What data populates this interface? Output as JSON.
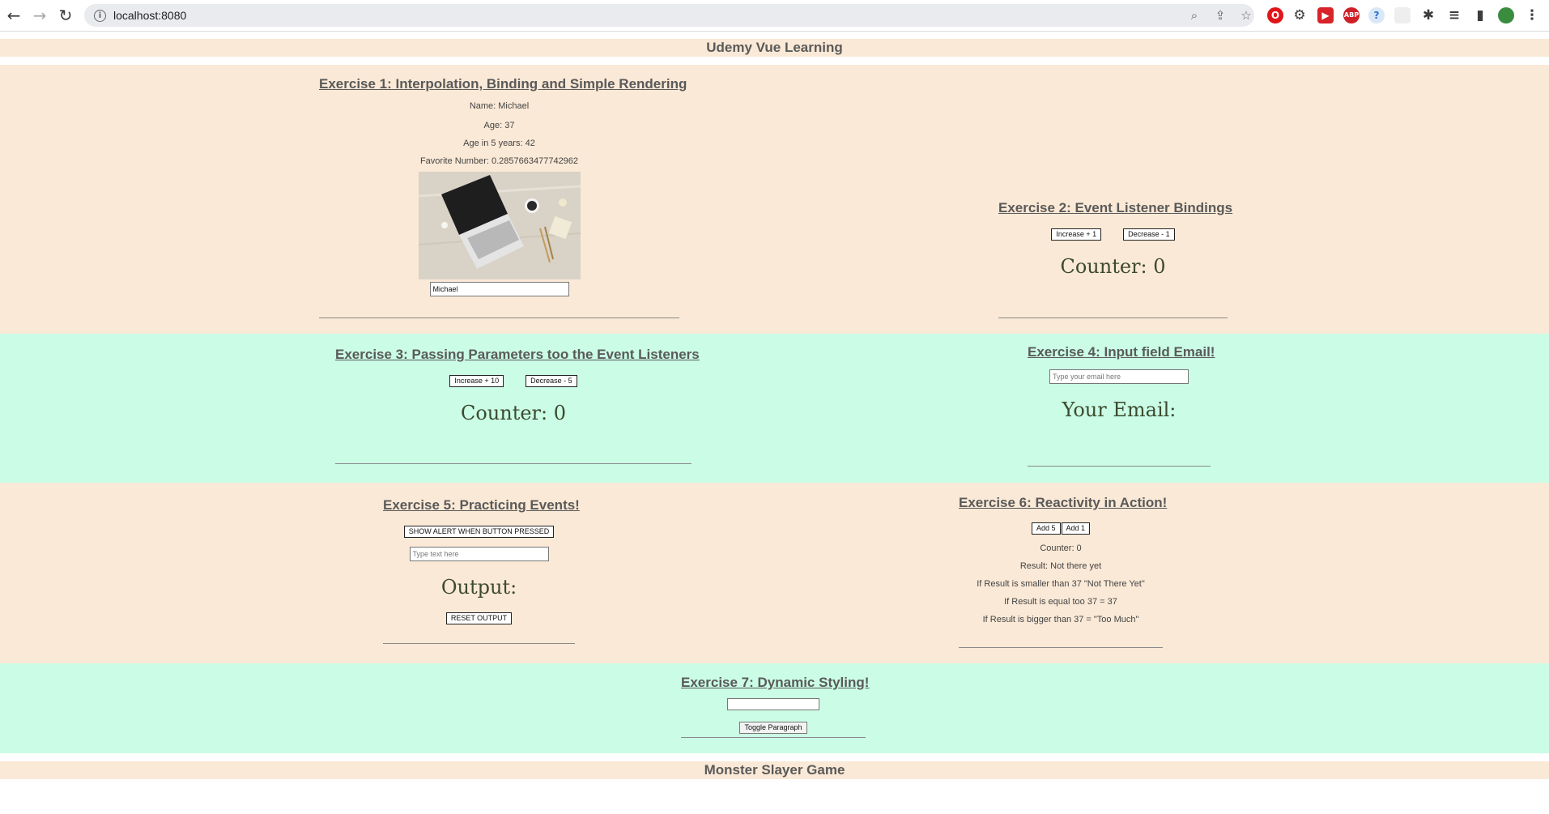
{
  "browser": {
    "url": "localhost:8080"
  },
  "header": {
    "title": "Udemy Vue Learning"
  },
  "footer": {
    "title": "Monster Slayer Game"
  },
  "ex1": {
    "title": "Exercise 1: Interpolation, Binding and Simple Rendering",
    "name": "Name: Michael",
    "age": "Age: 37",
    "age5": "Age in 5 years: 42",
    "fav": "Favorite Number: 0.2857663477742962",
    "input_value": "Michael"
  },
  "ex2": {
    "title": "Exercise 2: Event Listener Bindings",
    "inc": "Increase + 1",
    "dec": "Decrease - 1",
    "counter": "Counter: 0"
  },
  "ex3": {
    "title": "Exercise 3: Passing Parameters too the Event Listeners",
    "inc": "Increase + 10",
    "dec": "Decrease - 5",
    "counter": "Counter: 0"
  },
  "ex4": {
    "title": "Exercise 4: Input field Email!",
    "placeholder": "Type your email here",
    "label": "Your Email:"
  },
  "ex5": {
    "title": "Exercise 5: Practicing Events!",
    "alert_btn": "SHOW ALERT WHEN BUTTON PRESSED",
    "placeholder": "Type text here",
    "output": "Output:",
    "reset": "RESET OUTPUT"
  },
  "ex6": {
    "title": "Exercise 6: Reactivity in Action!",
    "add5": "Add 5",
    "add1": "Add 1",
    "counter": "Counter: 0",
    "result": "Result: Not there yet",
    "rule1": "If Result is smaller than 37 \"Not There Yet\"",
    "rule2": "If Result is equal too 37 = 37",
    "rule3": "If Result is bigger than 37 = \"Too Much\""
  },
  "ex7": {
    "title": "Exercise 7: Dynamic Styling!",
    "toggle": "Toggle Paragraph"
  },
  "colors": {
    "tan": "#fae9d6",
    "mint": "#cafce6"
  }
}
